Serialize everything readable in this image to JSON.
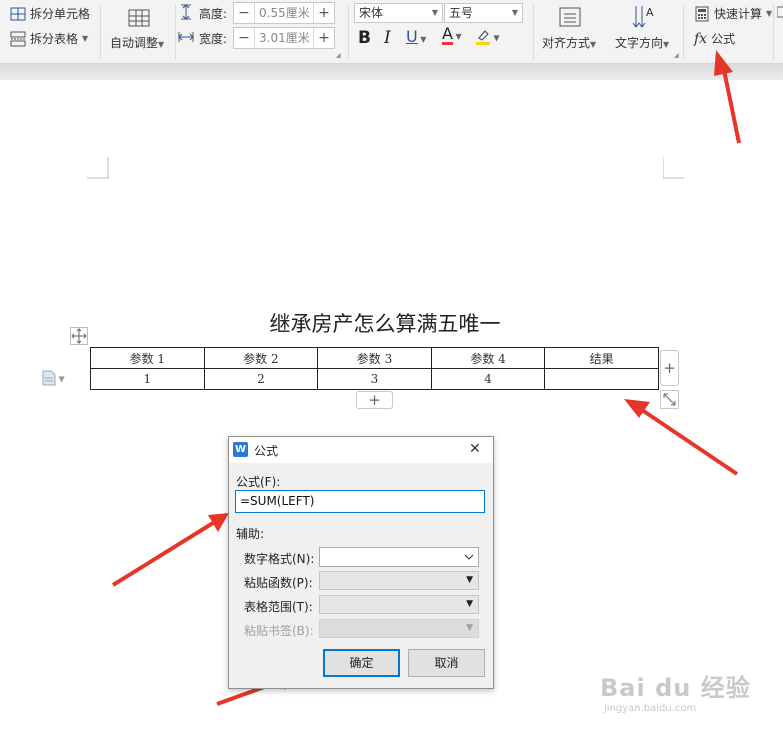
{
  "ribbon": {
    "split_cells": "拆分单元格",
    "split_table": "拆分表格",
    "auto_adjust": "自动调整",
    "height_label": "高度:",
    "height_value": "0.55厘米",
    "width_label": "宽度:",
    "width_value": "3.01厘米",
    "font_name": "宋体",
    "font_size": "五号",
    "bold": "B",
    "italic": "I",
    "underline": "U",
    "font_color": "A",
    "align": "对齐方式",
    "text_direction": "文字方向",
    "quick_calc": "快速计算",
    "formula_fx": "fx",
    "formula": "公式",
    "minus": "−",
    "plus": "+"
  },
  "document": {
    "title": "继承房产怎么算满五唯一",
    "table": {
      "headers": [
        "参数 1",
        "参数 2",
        "参数 3",
        "参数 4",
        "结果"
      ],
      "row": [
        "1",
        "2",
        "3",
        "4",
        ""
      ]
    },
    "add_col": "+",
    "add_row": "+"
  },
  "dialog": {
    "title": "公式",
    "app_icon": "W",
    "close": "✕",
    "formula_label": "公式(F):",
    "formula_value": "=SUM(LEFT)",
    "aux_label": "辅助:",
    "number_format_label": "数字格式(N):",
    "paste_function_label": "粘贴函数(P):",
    "table_range_label": "表格范围(T):",
    "paste_bookmark_label": "粘贴书签(B):",
    "ok": "确定",
    "cancel": "取消"
  },
  "watermark": {
    "brand": "Bai du 经验",
    "url": "jingyan.baidu.com"
  },
  "colors": {
    "arrow": "#e8352a",
    "accent_blue": "#2b579a",
    "font_color_bar": "#e63b2e",
    "highlight_bar": "#f5d90a"
  }
}
